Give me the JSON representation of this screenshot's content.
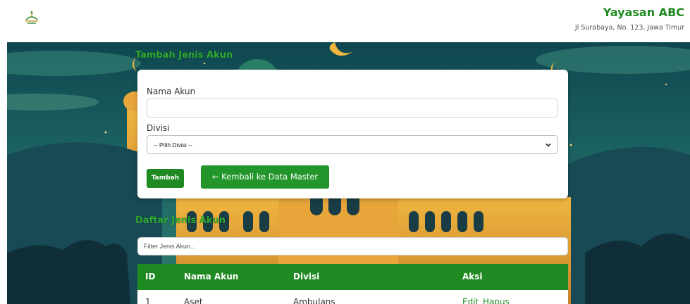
{
  "header": {
    "org_name": "Yayasan ABC",
    "org_address": "Jl Surabaya, No. 123, Jawa Timur",
    "logo_icon": "mosque-logo-icon"
  },
  "form": {
    "title": "Tambah Jenis Akun",
    "nama_label": "Nama Akun",
    "nama_value": "",
    "divisi_label": "Divisi",
    "divisi_selected": "-- Pilih Divisi --",
    "submit_label": "Tambah",
    "back_label": "← Kembali ke Data Master"
  },
  "list": {
    "title": "Daftar Jenis Akun",
    "filter_placeholder": "Filter Jenis Akun...",
    "columns": [
      "ID",
      "Nama Akun",
      "Divisi",
      "Aksi"
    ],
    "rows": [
      {
        "id": "1",
        "nama": "Aset",
        "divisi": "Ambulans",
        "edit": "Edit",
        "hapus": "Hapus"
      }
    ]
  },
  "colors": {
    "brand_green": "#1f8a22",
    "heading_green": "#2fa82f",
    "sky_top": "#0f4750",
    "sky_bottom": "#2f7a6e"
  }
}
